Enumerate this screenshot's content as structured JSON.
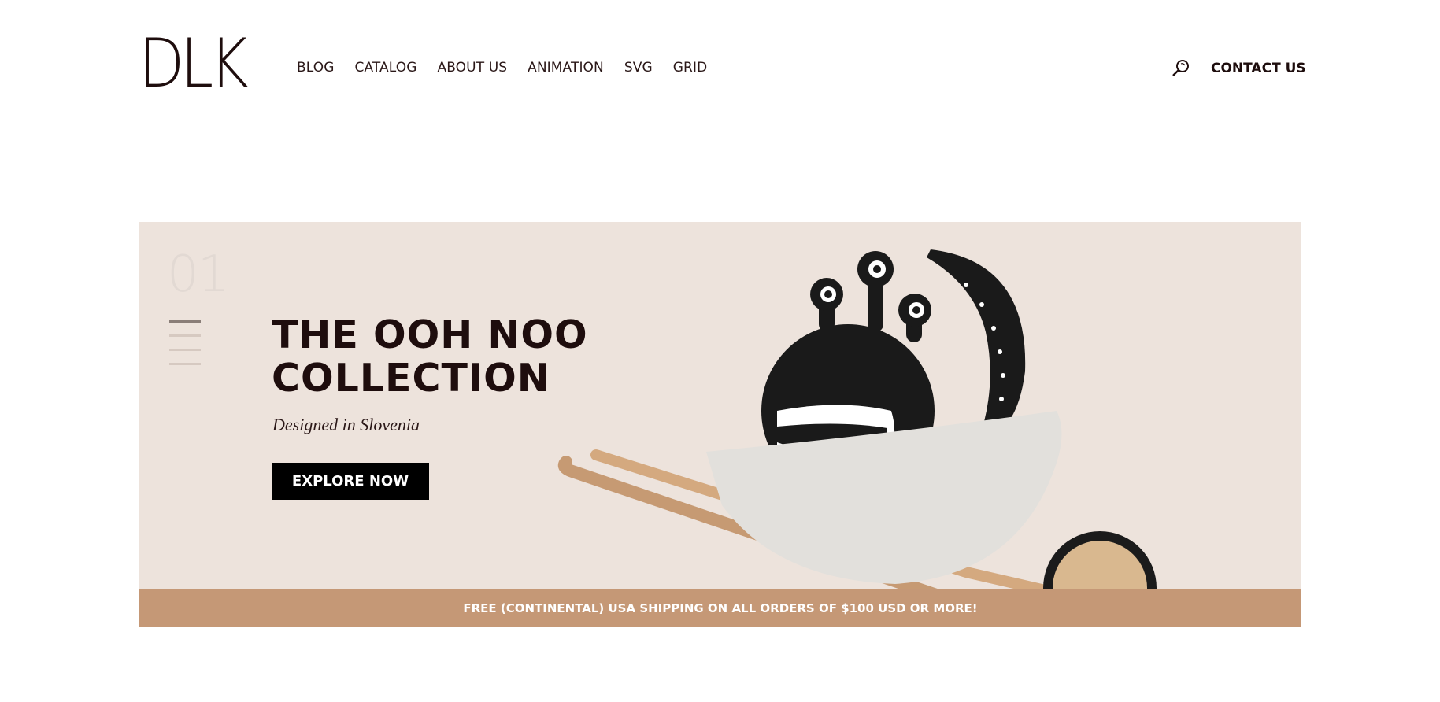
{
  "header": {
    "logo": "DLK",
    "nav": [
      "BLOG",
      "CATALOG",
      "ABOUT US",
      "ANIMATION",
      "SVG",
      "GRID"
    ],
    "search_icon": "search-icon",
    "contact_label": "CONTACT US"
  },
  "hero": {
    "slide_number": "01",
    "headline_line1": "THE OOH NOO",
    "headline_line2": "COLLECTION",
    "subtitle": "Designed in Slovenia",
    "cta_label": "EXPLORE NOW",
    "pager_count": 4,
    "pager_active": 1
  },
  "banner": {
    "text": "FREE (CONTINENTAL) USA SHIPPING ON ALL ORDERS OF $100 USD OR MORE!"
  },
  "colors": {
    "hero_bg": "#ede3dc",
    "banner_bg": "#c59876",
    "text_dark": "#1e0d0d",
    "cta_bg": "#000000"
  }
}
